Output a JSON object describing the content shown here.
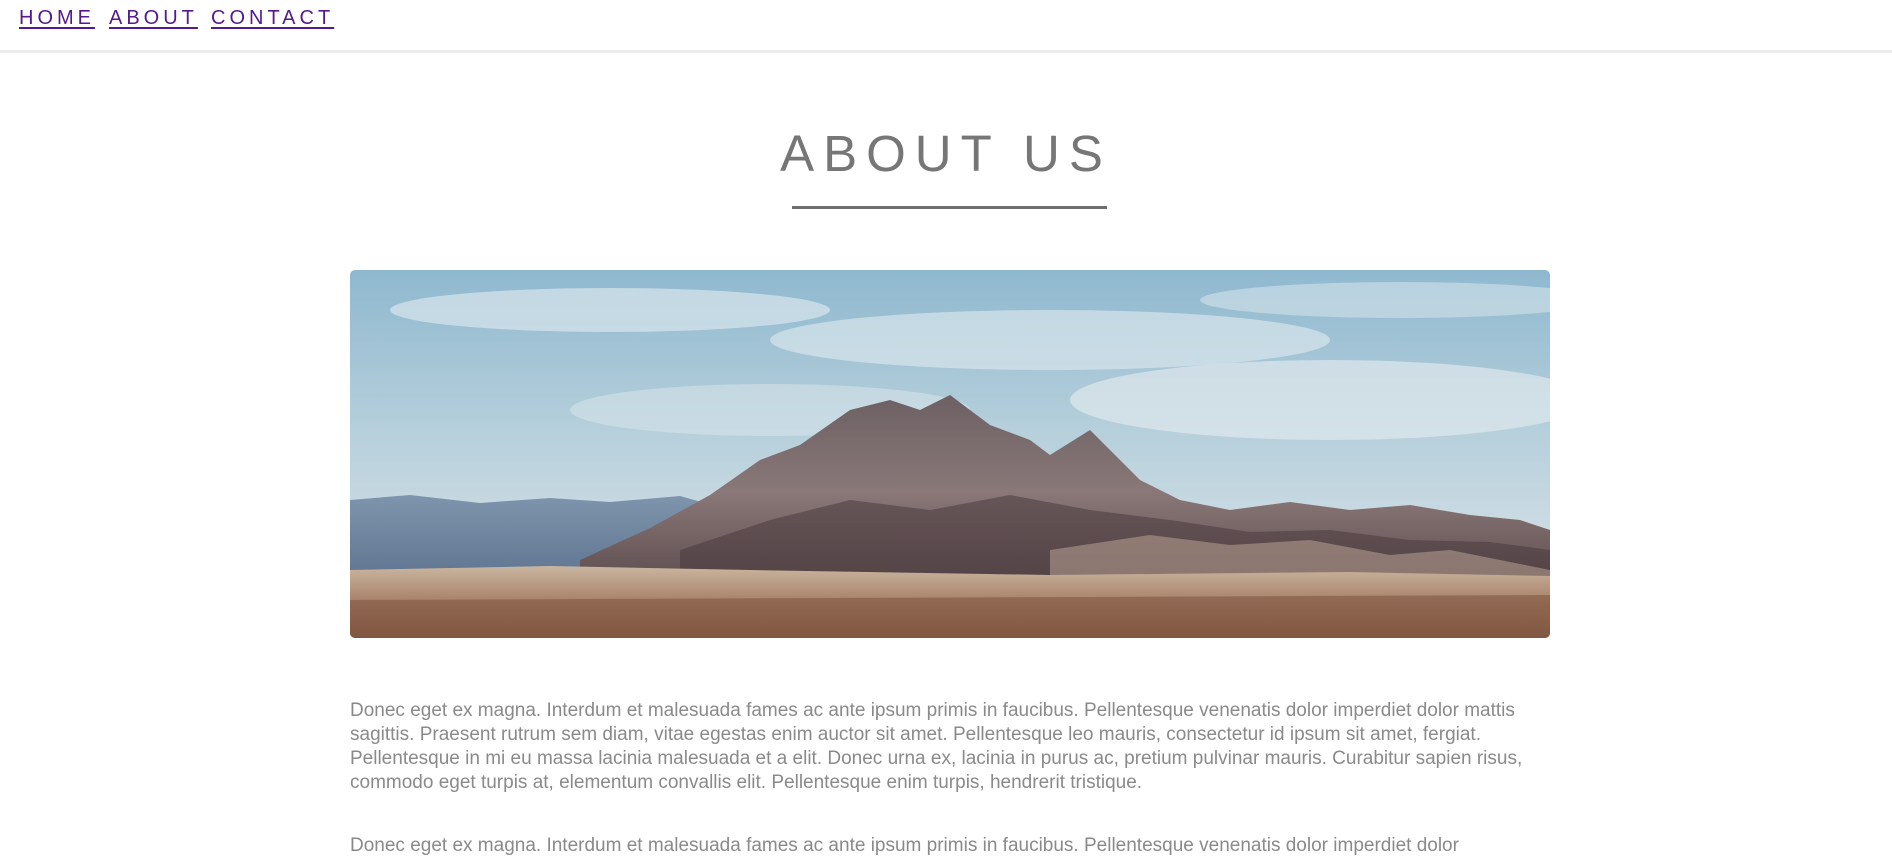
{
  "nav": {
    "items": [
      {
        "label": "HOME"
      },
      {
        "label": "ABOUT"
      },
      {
        "label": "CONTACT"
      }
    ],
    "link_color": "#551a8b"
  },
  "page": {
    "title": "ABOUT US"
  },
  "hero_image": {
    "subject": "desert mountain landscape under a cloudy blue sky"
  },
  "content": {
    "paragraphs": [
      "Donec eget ex magna. Interdum et malesuada fames ac ante ipsum primis in faucibus. Pellentesque venenatis dolor imperdiet dolor mattis sagittis. Praesent rutrum sem diam, vitae egestas enim auctor sit amet. Pellentesque leo mauris, consectetur id ipsum sit amet, fergiat. Pellentesque in mi eu massa lacinia malesuada et a elit. Donec urna ex, lacinia in purus ac, pretium pulvinar mauris. Curabitur sapien risus, commodo eget turpis at, elementum convallis elit. Pellentesque enim turpis, hendrerit tristique.",
      "Donec eget ex magna. Interdum et malesuada fames ac ante ipsum primis in faucibus. Pellentesque venenatis dolor imperdiet dolor"
    ]
  },
  "colors": {
    "text_gray": "#8a8a8a",
    "title_gray": "#767676"
  }
}
